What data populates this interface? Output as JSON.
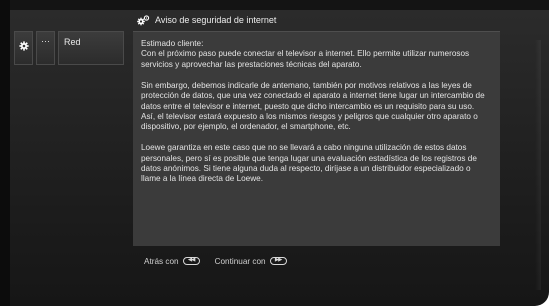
{
  "menu": {
    "dots_label": "···",
    "red_label": "Red"
  },
  "dialog": {
    "title": "Aviso de seguridad de internet",
    "paragraphs": [
      "Estimado cliente:\nCon el próximo paso puede conectar el televisor a internet. Ello permite utilizar numerosos servicios y aprovechar las prestaciones técnicas del aparato.",
      "Sin embargo, debemos indicarle de antemano, también por motivos relativos a las leyes de protección de datos, que una vez conectado el aparato a internet tiene lugar un intercambio de datos entre el televisor e internet, puesto que dicho intercambio es un requisito para su uso. Así, el televisor estará expuesto a los mismos riesgos y peligros que cualquier otro aparato o dispositivo, por ejemplo, el ordenador, el smartphone, etc.",
      "Loewe garantiza en este caso que no se llevará a cabo ninguna utilización de estos datos personales, pero sí es posible que tenga lugar una evaluación estadística de los registros de datos anónimos. Si tiene alguna duda al respecto, diríjase a un distribuidor especializado o llame a la línea directa de Loewe."
    ]
  },
  "footer": {
    "back_label": "Atrás con",
    "back_key": "◀◀",
    "continue_label": "Continuar con",
    "continue_key": "▶▶"
  },
  "icons": {
    "settings": "gear-icon",
    "dialog": "gears-icon",
    "rewind": "rewind-key-icon",
    "forward": "forward-key-icon"
  }
}
